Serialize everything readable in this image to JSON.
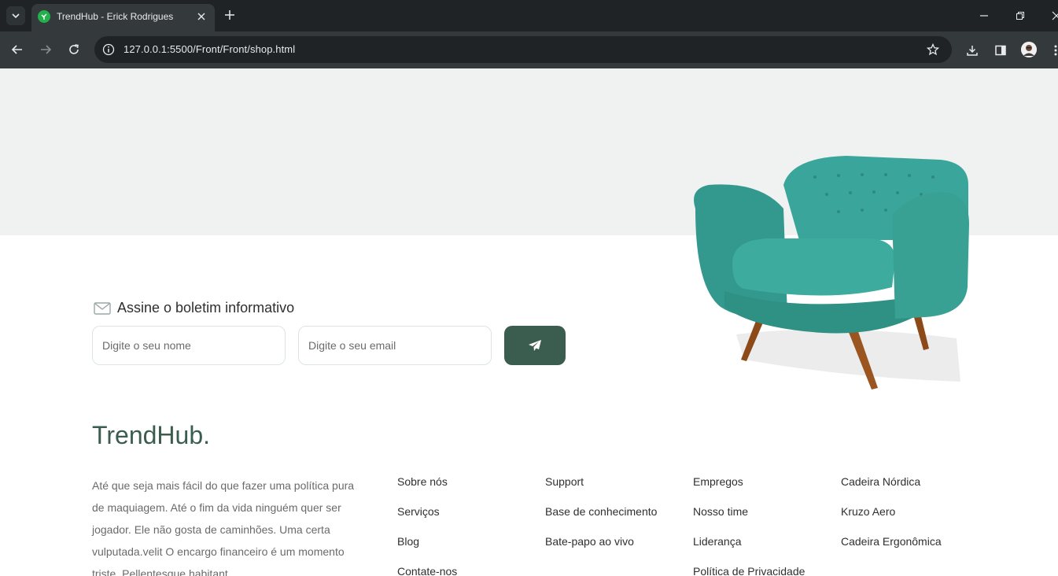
{
  "browser": {
    "tab_title": "TrendHub - Erick Rodrigues",
    "url": "127.0.0.1:5500/Front/Front/shop.html",
    "icons": [
      "tab-search-icon",
      "favicon-icon",
      "close-icon",
      "plus-icon",
      "minimize-icon",
      "restore-icon",
      "back-icon",
      "forward-icon",
      "reload-icon",
      "site-info-icon",
      "star-icon",
      "download-icon",
      "side-panel-icon",
      "avatar",
      "menu-icon"
    ]
  },
  "newsletter": {
    "title": "Assine o boletim informativo",
    "name_placeholder": "Digite o seu nome",
    "email_placeholder": "Digite o seu email"
  },
  "footer": {
    "brand": "TrendHub.",
    "about": "Até que seja mais fácil do que fazer uma política pura de maquiagem. Até o fim da vida ninguém quer ser jogador. Ele não gosta de caminhões. Uma certa vulputada.velit O encargo financeiro é um momento triste. Pellentesque habitant",
    "col1": [
      "Sobre nós",
      "Serviços",
      "Blog",
      "Contate-nos"
    ],
    "col2": [
      "Support",
      "Base de conhecimento",
      "Bate-papo ao vivo"
    ],
    "col3": [
      "Empregos",
      "Nosso time",
      "Liderança",
      "Política de Privacidade"
    ],
    "col4": [
      "Cadeira Nórdica",
      "Kruzo Aero",
      "Cadeira Ergonômica"
    ]
  },
  "colors": {
    "accent": "#3b5d50",
    "hero_band": "#eff2f1",
    "chair": "#3aa59a"
  }
}
